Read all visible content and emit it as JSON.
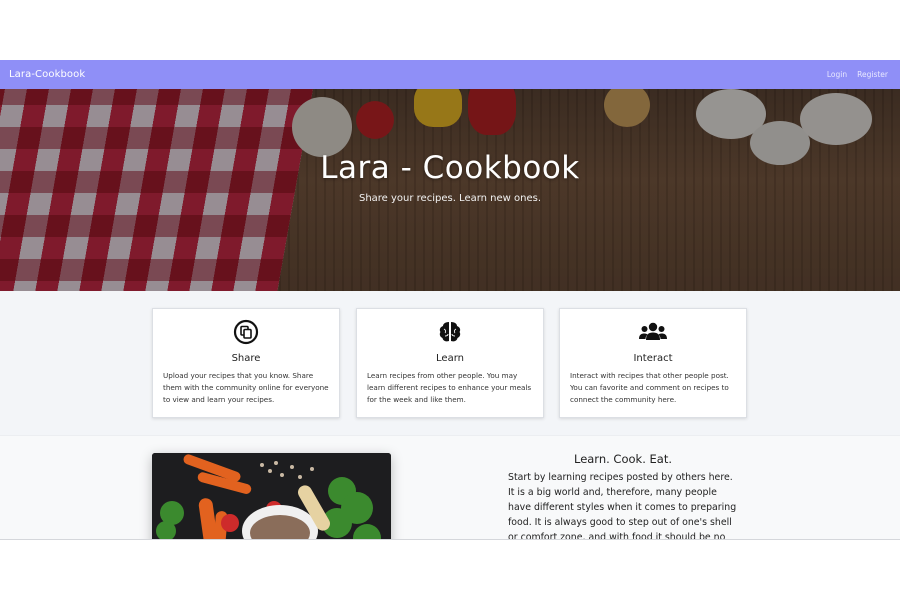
{
  "navbar": {
    "brand": "Lara-Cookbook",
    "links": [
      "Login",
      "Register"
    ]
  },
  "hero": {
    "title": "Lara - Cookbook",
    "subtitle": "Share your recipes. Learn new ones."
  },
  "features": [
    {
      "icon": "copy-icon",
      "title": "Share",
      "text": "Upload your recipes that you know. Share them with the community online for everyone to view and learn your recipes."
    },
    {
      "icon": "brain-icon",
      "title": "Learn",
      "text": "Learn recipes from other people. You may learn different recipes to enhance your meals for the week and like them."
    },
    {
      "icon": "users-icon",
      "title": "Interact",
      "text": "Interact with recipes that other people post. You can favorite and comment on recipes to connect the community here."
    }
  ],
  "about": {
    "title": "Learn. Cook. Eat.",
    "text": "Start by learning recipes posted by others here. It is a big world and, therefore, many people have different styles when it comes to preparing food. It is always good to step out of one's shell or comfort zone, and with food it should be no different (unless of course..."
  },
  "colors": {
    "navbar": "#8f8ff7",
    "section_bg": "#f3f5f8"
  }
}
